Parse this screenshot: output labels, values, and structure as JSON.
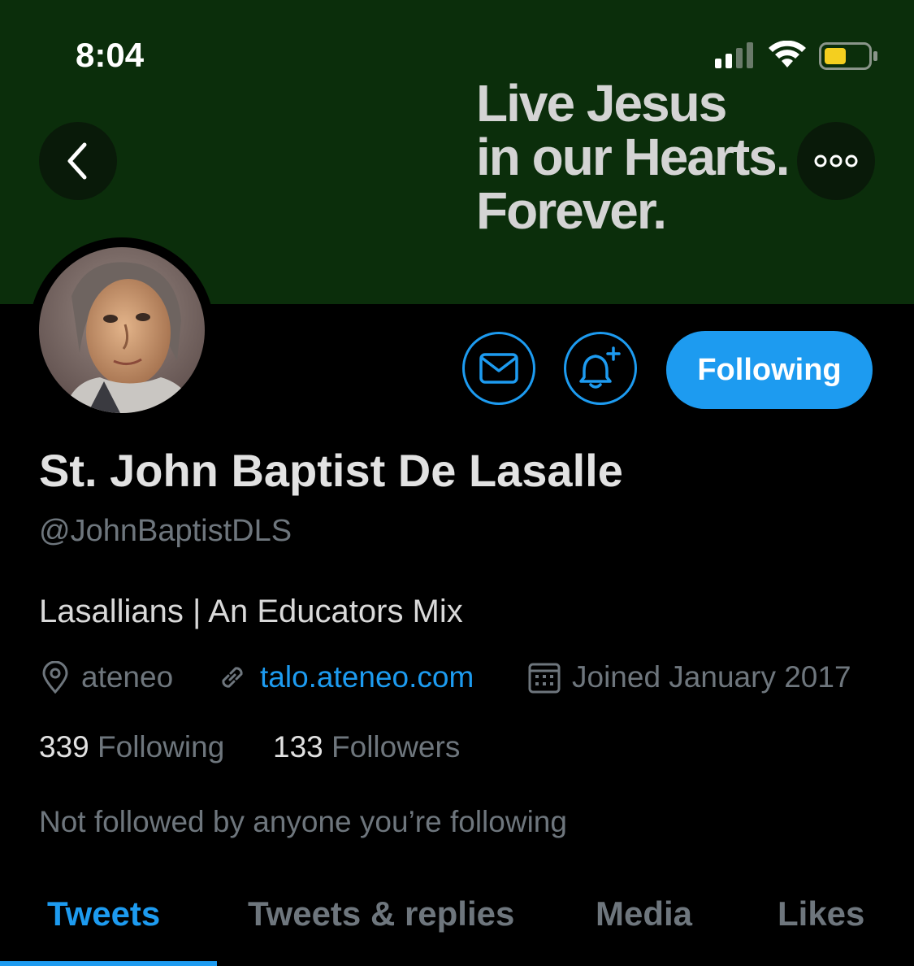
{
  "status_bar": {
    "time": "8:04"
  },
  "banner": {
    "lines": [
      "Live Jesus",
      "in our Hearts.",
      "Forever."
    ],
    "background_color": "#0b2e0b"
  },
  "header": {
    "back_icon": "chevron-left-icon",
    "more_icon": "more-icon"
  },
  "profile": {
    "name": "St. John Baptist De Lasalle",
    "handle": "@JohnBaptistDLS",
    "bio": "Lasallians | An Educators Mix",
    "location": "ateneo",
    "website": "talo.ateneo.com",
    "joined": "Joined January 2017",
    "following_count": "339",
    "following_label": "Following",
    "followers_count": "133",
    "followers_label": "Followers",
    "mutuals_note": "Not followed by anyone you’re following"
  },
  "actions": {
    "follow_button_label": "Following",
    "accent_color": "#1d9bf0"
  },
  "tabs": [
    {
      "label": "Tweets",
      "active": true
    },
    {
      "label": "Tweets & replies",
      "active": false
    },
    {
      "label": "Media",
      "active": false
    },
    {
      "label": "Likes",
      "active": false
    }
  ]
}
